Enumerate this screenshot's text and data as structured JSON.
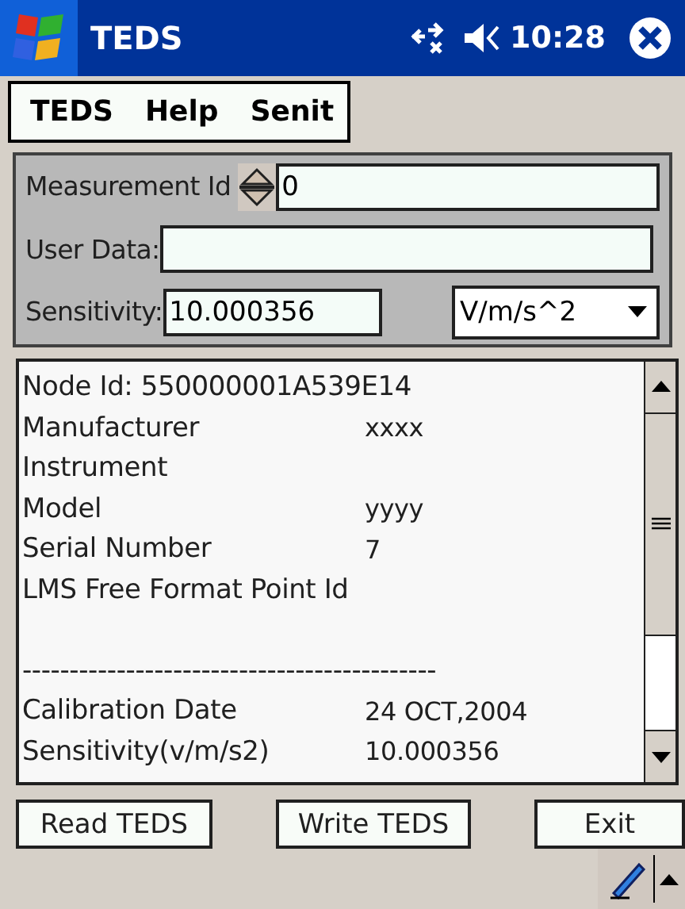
{
  "title_bar": {
    "title": "TEDS",
    "time": "10:28"
  },
  "menu": [
    "TEDS",
    "Help",
    "Senit"
  ],
  "form": {
    "measurement_id": {
      "label": "Measurement Id",
      "value": "0"
    },
    "user_data": {
      "label": "User Data:"
    },
    "sensitivity": {
      "label": "Sensitivity:",
      "value": "10.000356"
    },
    "unit": {
      "value": "V/m/s^2"
    }
  },
  "info_list": [
    {
      "kind": "line",
      "text": "Node Id: 550000001A539E14"
    },
    {
      "kind": "pair",
      "label": "Manufacturer",
      "value": "xxxx"
    },
    {
      "kind": "pair",
      "label": "Instrument"
    },
    {
      "kind": "pair",
      "label": "Model",
      "value": "yyyy"
    },
    {
      "kind": "pair",
      "label": "Serial Number",
      "value": "7"
    },
    {
      "kind": "line",
      "text": "LMS Free Format Point Id"
    },
    {
      "kind": "gap"
    },
    {
      "kind": "line",
      "text": "--------------------------------------------"
    },
    {
      "kind": "pair",
      "label": "Calibration Date",
      "value": "24 OCT,2004"
    },
    {
      "kind": "pair",
      "label": "Sensitivity(v/m/s2)",
      "value": "10.000356"
    }
  ],
  "buttons": [
    "Read TEDS",
    "Write TEDS",
    "Exit"
  ]
}
